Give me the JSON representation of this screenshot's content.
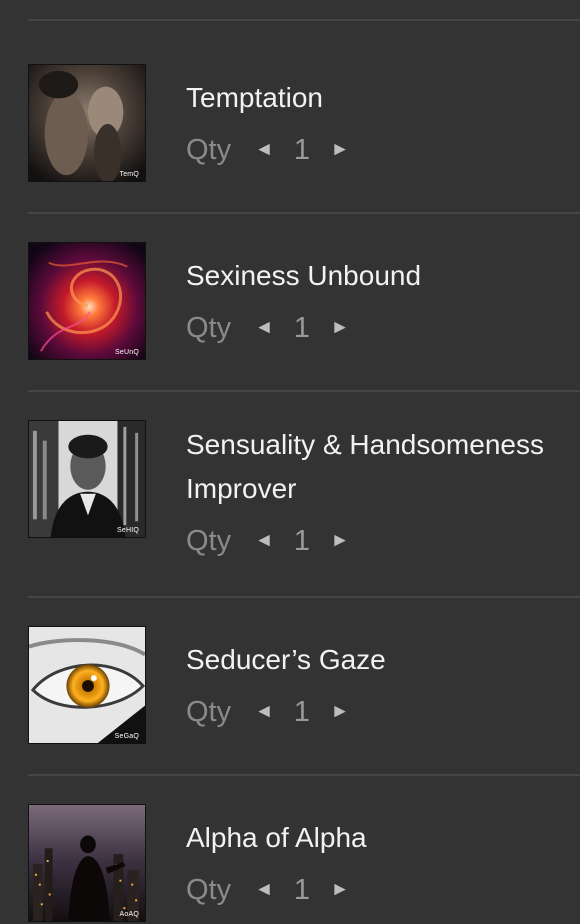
{
  "cart": {
    "qty_label": "Qty",
    "decrement_symbol": "◄",
    "increment_symbol": "►",
    "items": [
      {
        "title": "Temptation",
        "qty": "1",
        "code": "TemQ"
      },
      {
        "title": "Sexiness Unbound",
        "qty": "1",
        "code": "SeUnQ"
      },
      {
        "title": "Sensuality & Handsomeness Improver",
        "qty": "1",
        "code": "SeHIQ"
      },
      {
        "title": "Seducer’s Gaze",
        "qty": "1",
        "code": "SeGaQ"
      },
      {
        "title": "Alpha of Alpha",
        "qty": "1",
        "code": "AoAQ"
      }
    ]
  },
  "colors": {
    "background": "#333333",
    "divider": "#454545",
    "title_text": "#f2f2f2",
    "qty_text": "#8a8a8a"
  }
}
